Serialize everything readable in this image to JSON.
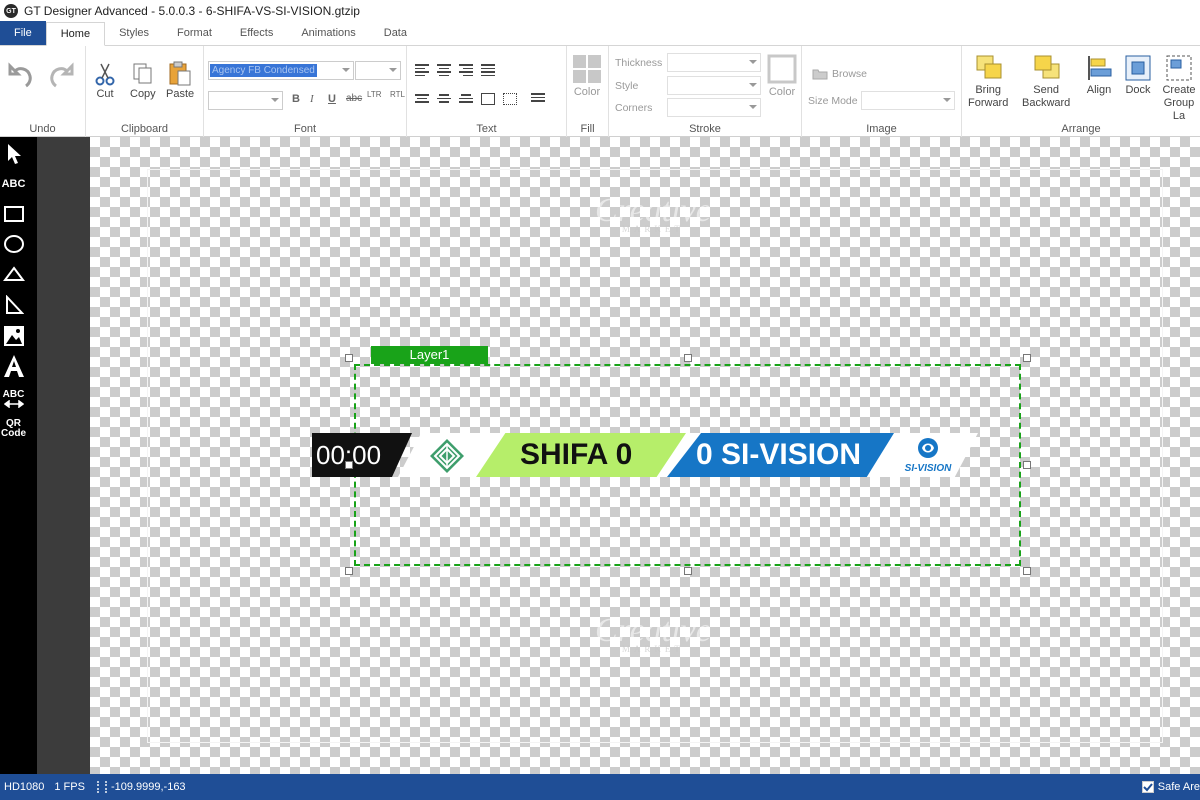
{
  "window": {
    "title": "GT Designer Advanced - 5.0.0.3 - 6-SHIFA-VS-SI-VISION.gtzip",
    "icon": "gt-app-icon"
  },
  "tabs": [
    "File",
    "Home",
    "Styles",
    "Format",
    "Effects",
    "Animations",
    "Data"
  ],
  "ribbon": {
    "undo": {
      "label": "Undo"
    },
    "clipboard": {
      "label": "Clipboard",
      "cut": "Cut",
      "copy": "Copy",
      "paste": "Paste"
    },
    "font": {
      "label": "Font",
      "family_value": "Agency FB Condensed",
      "bold": "B",
      "italic": "I",
      "underline": "U",
      "strike": "abc",
      "ltr": "LTR",
      "rtl": "RTL"
    },
    "text": {
      "label": "Text"
    },
    "fill": {
      "label": "Fill",
      "color": "Color"
    },
    "stroke": {
      "label": "Stroke",
      "thickness": "Thickness",
      "style": "Style",
      "corners": "Corners",
      "color": "Color"
    },
    "image": {
      "label": "Image",
      "browse": "Browse",
      "size_mode": "Size Mode"
    },
    "arrange": {
      "label": "Arrange",
      "bring_forward_1": "Bring",
      "bring_forward_2": "Forward",
      "send_backward_1": "Send",
      "send_backward_2": "Backward",
      "align": "Align",
      "dock": "Dock",
      "create_group_1": "Create",
      "create_group_2": "Group La"
    }
  },
  "tools": {
    "text": "ABC",
    "text_scroll": "ABC",
    "qr_1": "QR",
    "qr_2": "Code"
  },
  "canvas": {
    "layer_name": "Layer1",
    "scorebug": {
      "timer": "00:00",
      "team1": "SHIFA 0",
      "team2": "0 SI-VISION",
      "logo2_text": "SI-VISION"
    },
    "watermark": "Creative",
    "watermark_sub": "MARKET"
  },
  "status": {
    "resolution": "HD1080",
    "fps": "1 FPS",
    "coords": "-109.9999,-163",
    "safe_area": "Safe Are"
  },
  "colors": {
    "accent": "#1f4e96",
    "layer_green": "#19a319",
    "team1_green": "#b6ee6a",
    "team2_blue": "#1676c6"
  }
}
